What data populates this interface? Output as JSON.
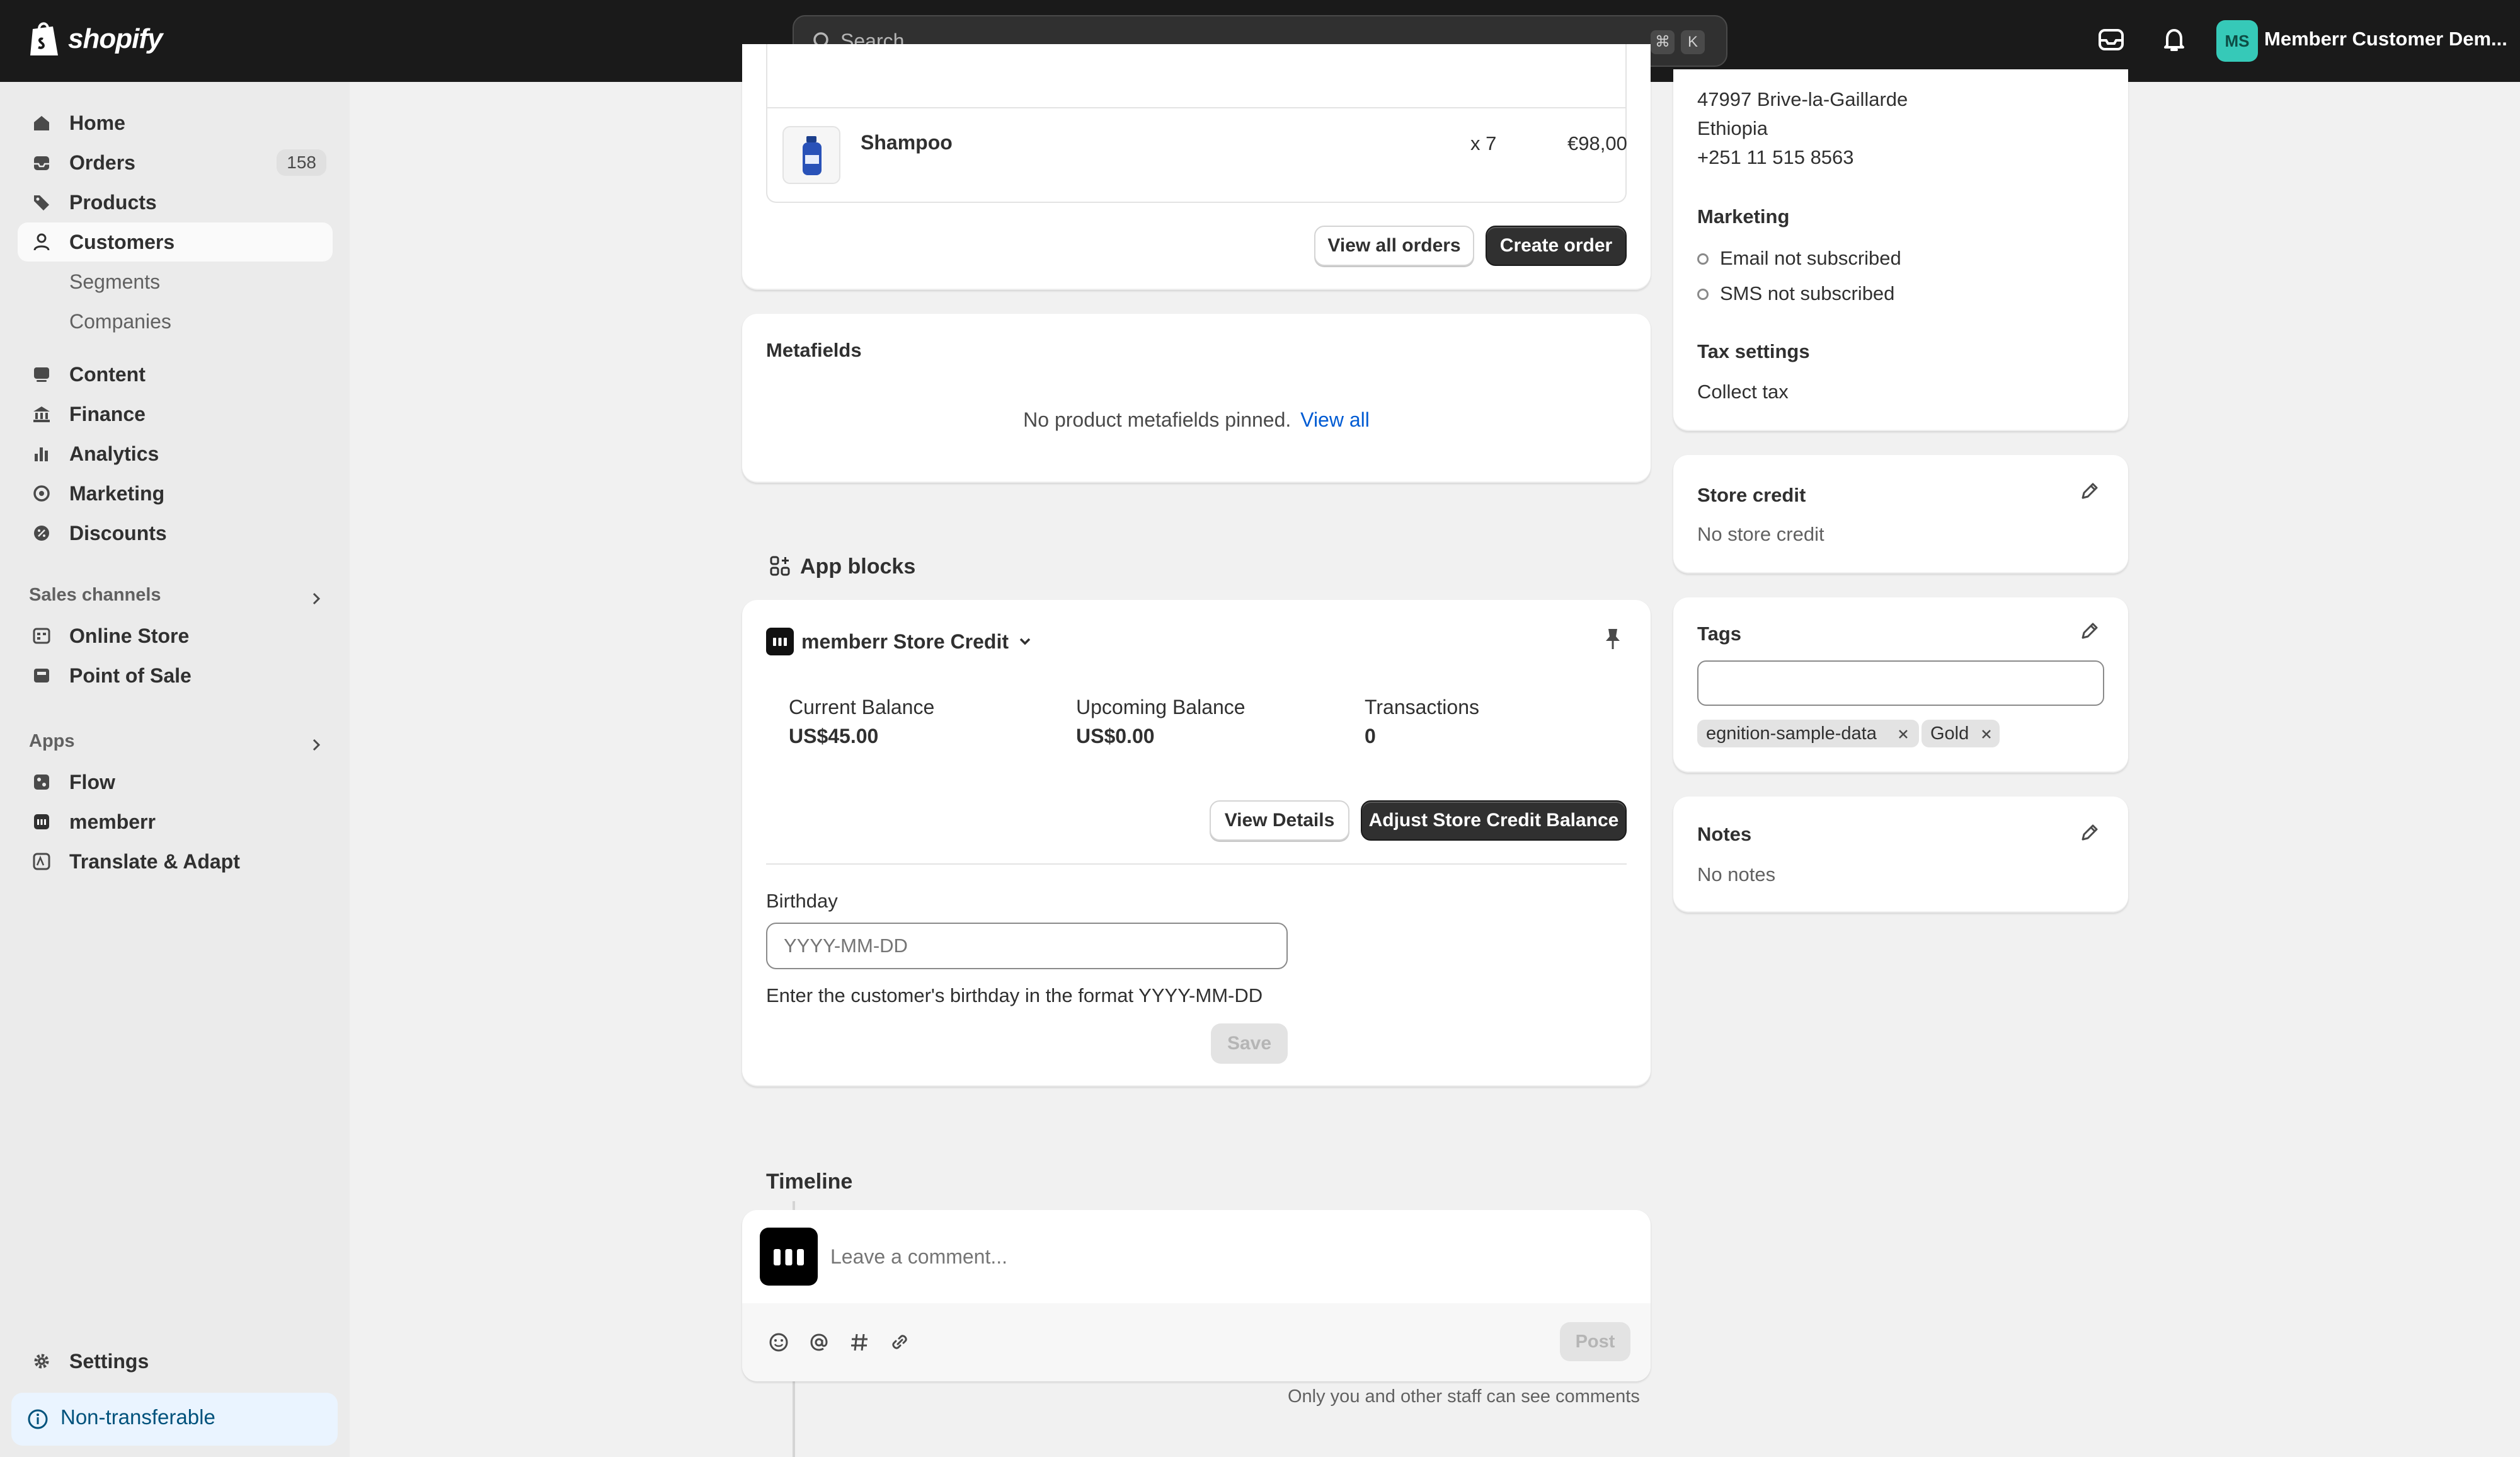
{
  "app": {
    "brand": "shopify",
    "store_name": "Memberr Customer Dem...",
    "avatar_initials": "MS"
  },
  "search": {
    "placeholder": "Search",
    "shortcut_cmd": "⌘",
    "shortcut_key": "K"
  },
  "sidebar": {
    "items": [
      {
        "label": "Home",
        "icon": "home-icon"
      },
      {
        "label": "Orders",
        "icon": "orders-icon",
        "badge": "158"
      },
      {
        "label": "Products",
        "icon": "tag-icon"
      },
      {
        "label": "Customers",
        "icon": "person-icon",
        "active": true
      },
      {
        "label": "Segments"
      },
      {
        "label": "Companies"
      },
      {
        "label": "Content",
        "icon": "content-icon"
      },
      {
        "label": "Finance",
        "icon": "bank-icon"
      },
      {
        "label": "Analytics",
        "icon": "bar-chart-icon"
      },
      {
        "label": "Marketing",
        "icon": "target-icon"
      },
      {
        "label": "Discounts",
        "icon": "discount-icon"
      }
    ],
    "sales_channels_heading": "Sales channels",
    "sales_channels": [
      {
        "label": "Online Store",
        "icon": "store-icon"
      },
      {
        "label": "Point of Sale",
        "icon": "pos-icon"
      }
    ],
    "apps_heading": "Apps",
    "apps": [
      {
        "label": "Flow",
        "icon": "flow-icon"
      },
      {
        "label": "memberr",
        "icon": "memberr-icon"
      },
      {
        "label": "Translate & Adapt",
        "icon": "translate-icon"
      }
    ],
    "settings_label": "Settings",
    "non_transferable_label": "Non-transferable"
  },
  "orders_card": {
    "item_name": "Shampoo",
    "item_qty": "x 7",
    "item_price": "€98,00",
    "view_all_label": "View all orders",
    "create_label": "Create order"
  },
  "metafields": {
    "title": "Metafields",
    "empty_text": "No product metafields pinned.",
    "view_all_link": "View all"
  },
  "app_blocks": {
    "heading": "App blocks",
    "app_name": "memberr Store Credit",
    "stats": [
      {
        "label": "Current Balance",
        "value": "US$45.00"
      },
      {
        "label": "Upcoming Balance",
        "value": "US$0.00"
      },
      {
        "label": "Transactions",
        "value": "0"
      }
    ],
    "view_details_label": "View Details",
    "adjust_label": "Adjust Store Credit Balance",
    "birthday_label": "Birthday",
    "birthday_placeholder": "YYYY-MM-DD",
    "birthday_help": "Enter the customer's birthday in the format YYYY-MM-DD",
    "save_label": "Save"
  },
  "timeline": {
    "heading": "Timeline",
    "comment_placeholder": "Leave a comment...",
    "post_label": "Post",
    "staff_note": "Only you and other staff can see comments"
  },
  "customer_panel": {
    "address_lines": [
      "47997 Brive-la-Gaillarde",
      "Ethiopia",
      "+251 11 515 8563"
    ],
    "marketing_heading": "Marketing",
    "email_status": "Email not subscribed",
    "sms_status": "SMS not subscribed",
    "tax_heading": "Tax settings",
    "tax_value": "Collect tax"
  },
  "store_credit": {
    "title": "Store credit",
    "value": "No store credit"
  },
  "tags": {
    "title": "Tags",
    "input_value": "",
    "items": [
      "egnition-sample-data",
      "Gold"
    ]
  },
  "notes": {
    "title": "Notes",
    "value": "No notes"
  },
  "colors": {
    "topbar": "#1a1a1a",
    "accent_link": "#005bd3",
    "primary_button": "#303030",
    "avatar_bg": "#36c9b8"
  }
}
